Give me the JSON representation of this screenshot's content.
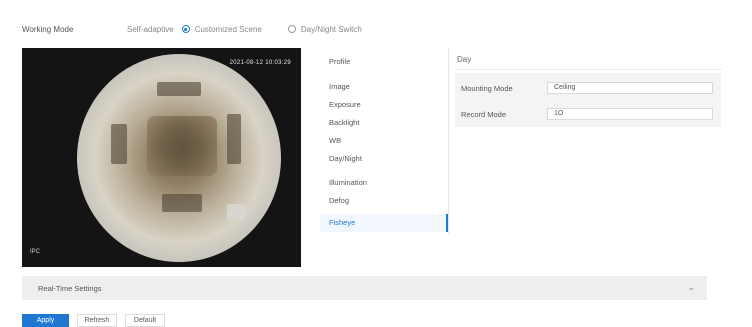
{
  "working_mode": {
    "label": "Working Mode",
    "self_adaptive_label": "Self-adaptive",
    "options": [
      {
        "label": "Customized Scene",
        "selected": true
      },
      {
        "label": "Day/Night Switch",
        "selected": false
      }
    ]
  },
  "preview": {
    "timestamp": "2021-08-12 10:03:29",
    "camera_label": "IPC"
  },
  "menu": {
    "profile_label": "Profile",
    "items": [
      "Image",
      "Exposure",
      "Backlight",
      "WB",
      "Day/Night",
      "Illumination",
      "Defog",
      "Fisheye"
    ],
    "active_index": 7
  },
  "profile": {
    "value": "Day"
  },
  "params": {
    "mounting_mode_label": "Mounting Mode",
    "mounting_mode_value": "Ceiling",
    "record_mode_label": "Record Mode",
    "record_mode_value": "1O"
  },
  "realtime": {
    "title": "Real-Time Settings"
  },
  "buttons": {
    "apply": "Apply",
    "refresh": "Refresh",
    "default": "Default"
  },
  "colors": {
    "accent": "#1e78d2"
  }
}
